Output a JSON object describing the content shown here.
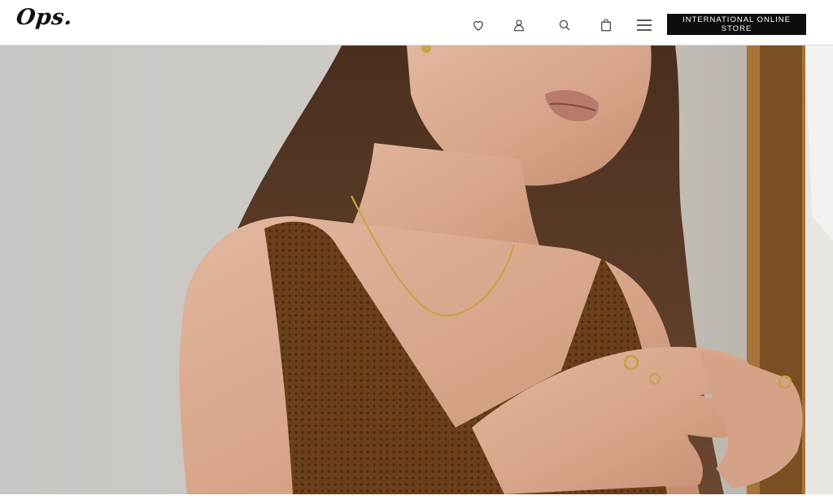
{
  "header": {
    "logo": "Ops.",
    "icons": [
      "heart-icon",
      "user-icon",
      "search-icon",
      "shopping-bag-icon",
      "menu-icon"
    ],
    "store_button_label": "INTERNATIONAL ONLINE STORE"
  },
  "hero": {
    "image": "woman-wearing-gold-necklace-and-rings",
    "colors": {
      "background_wall": "#cbc9c5",
      "skin": "#d9a98f",
      "hair": "#5a3a26",
      "top": "#6b3f1c",
      "gold": "#c9a14a",
      "mirror_frame": "#a7743a"
    }
  }
}
